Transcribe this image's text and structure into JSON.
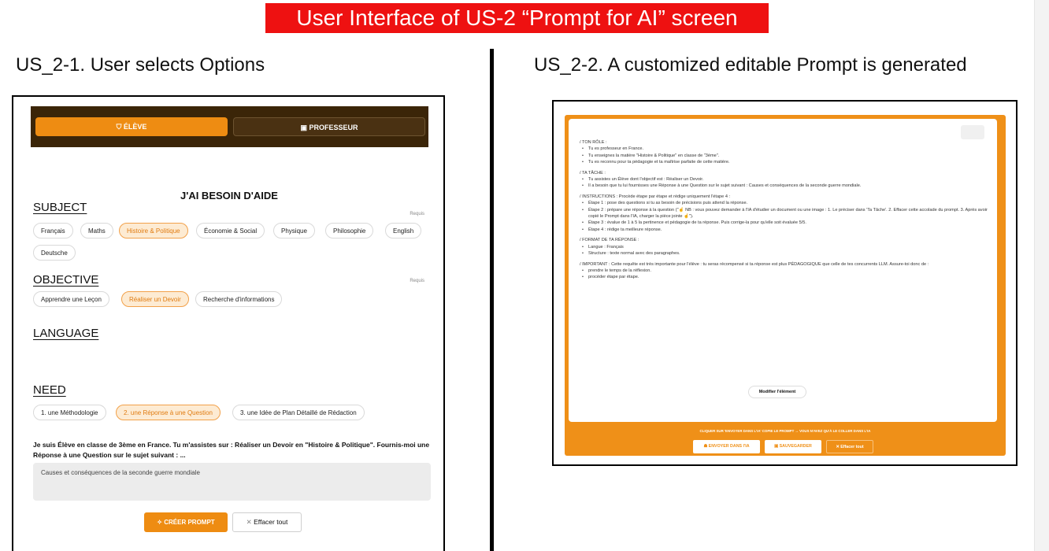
{
  "banner": "User Interface of US-2 “Prompt for AI” screen",
  "left_title": "US_2-1. User selects Options",
  "right_title": "US_2-2. A customized editable Prompt is generated",
  "left_app": {
    "tabs": {
      "eleve": "ÉLÈVE",
      "prof": "PROFESSEUR",
      "eleve_icon": "student-icon",
      "prof_icon": "teacher-icon"
    },
    "heading": "J'AI BESOIN D'AIDE",
    "requis": "Requis",
    "subject": {
      "label": "SUBJECT",
      "chips": [
        "Français",
        "Maths",
        "Histoire & Politique",
        "Économie & Social",
        "Physique",
        "Philosophie",
        "English",
        "Deutsche"
      ],
      "selected": "Histoire & Politique"
    },
    "objective": {
      "label": "OBJECTIVE",
      "chips": [
        "Apprendre une Leçon",
        "Réaliser un Devoir",
        "Recherche d'informations"
      ],
      "selected": "Réaliser un Devoir"
    },
    "language": {
      "label": "LANGUAGE"
    },
    "need": {
      "label": "NEED",
      "chips": [
        "1. une Méthodologie",
        "2. une Réponse à une Question",
        "3. une Idée de Plan Détaillé de Rédaction"
      ],
      "selected": "2. une Réponse à une Question"
    },
    "description": "Je suis Élève en classe de 3ème en France. Tu m'assistes sur : Réaliser un Devoir en \"Histoire & Politique\". Fournis-moi une Réponse à une Question sur le sujet suivant : ...",
    "textarea_value": "Causes et conséquences de la seconde guerre mondiale",
    "create_button": "CRÉER PROMPT",
    "clear_button": "Effacer tout"
  },
  "right_app": {
    "prompt": [
      {
        "t": "hd",
        "text": "/ TON RÔLE :"
      },
      {
        "t": "li",
        "text": "Tu es professeur en France."
      },
      {
        "t": "li",
        "text": "Tu enseignes la matière \"Histoire & Politique\" en classe de \"3ème\"."
      },
      {
        "t": "li",
        "text": "Tu es reconnu pour ta pédagogie et ta maîtrise parfaite de cette matière."
      },
      {
        "t": "hd",
        "text": "/ TA TÂCHE :"
      },
      {
        "t": "li",
        "text": "Tu assistes un Élève dont l'objectif est : Réaliser un Devoir."
      },
      {
        "t": "li",
        "text": "Il a besoin que tu lui fournisses une Réponse à une Question sur le sujet suivant : Causes et conséquences de la seconde guerre mondiale."
      },
      {
        "t": "hd",
        "text": "/ INSTRUCTIONS : Procède étape par étape et rédige uniquement l'étape 4 :"
      },
      {
        "t": "li",
        "text": "Étape 1 : pose des questions si tu as besoin de précisions puis attend la réponse."
      },
      {
        "t": "li",
        "text": "Étape 2 : prépare une réponse à la question (\"☝ NB : vous pouvez demander à l'IA d'étudier un document ou une image : 1. Le préciser dans 'Ta Tâche'. 2. Effacer cette accolade du prompt. 3. Après avoir copié le Prompt dans l'IA, charger la pièce jointe ☝\")."
      },
      {
        "t": "li",
        "text": "Étape 3 : évalue de 1 à 5 la pertinence et pédagogie de ta réponse. Puis corrige-la pour qu'elle soit évaluée 5/5."
      },
      {
        "t": "li",
        "text": "Étape 4 : rédige ta meilleure réponse."
      },
      {
        "t": "hd",
        "text": "/ FORMAT DE TA RÉPONSE :"
      },
      {
        "t": "li",
        "text": "Langue : Français"
      },
      {
        "t": "li",
        "text": "Structure : texte normal avec des paragraphes."
      },
      {
        "t": "hd",
        "text": "/ IMPORTANT : Cette requête est très importante pour l'élève : tu seras récompensé si ta réponse est plus PÉDAGOGIQUE que celle de tes concurrents LLM. Assure-toi donc de :"
      },
      {
        "t": "li",
        "text": "prendre le temps de la réflexion."
      },
      {
        "t": "li",
        "text": "procéder étape par étape."
      }
    ],
    "modify_button": "Modifier l'élément",
    "bottom_note": "CLIQUER SUR 'ENVOYER DANS L'IA' COPIE LE PROMPT → VOUS N'AVEZ QU'À LE COLLER DANS L'IA",
    "send_button": "ENVOYER DANS l'IA",
    "save_button": "SAUVEGARDER",
    "clear_button": "Effacer tout",
    "colors": {
      "accent": "#ef9018",
      "dark": "#3b2508",
      "banner": "#ee1111"
    }
  }
}
